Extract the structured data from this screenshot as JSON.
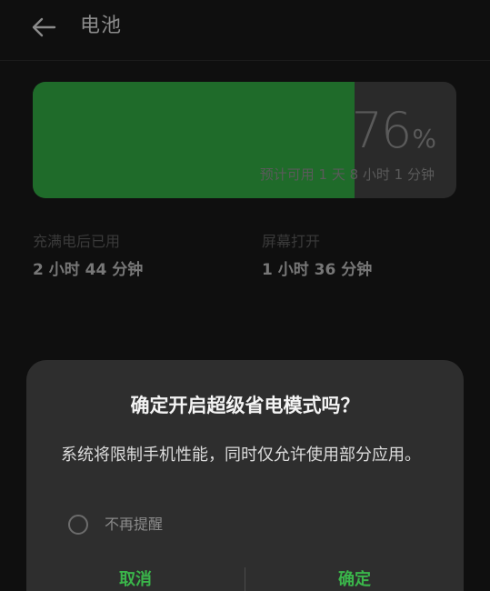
{
  "header": {
    "title": "电池",
    "back_icon": "arrow-left-icon"
  },
  "battery": {
    "level_percent": 76,
    "percent_number": "76",
    "percent_sign": "%",
    "estimate": "预计可用 1 天 8 小时 1 分钟",
    "fill_color": "#1f6b2a"
  },
  "stats": {
    "since_full": {
      "label": "充满电后已用",
      "value": "2 小时 44 分钟"
    },
    "screen_on": {
      "label": "屏幕打开",
      "value": "1 小时 36 分钟"
    }
  },
  "dialog": {
    "title": "确定开启超级省电模式吗？",
    "message": "系统将限制手机性能，同时仅允许使用部分应用。",
    "dont_remind_label": "不再提醒",
    "cancel_label": "取消",
    "confirm_label": "确定",
    "accent_color": "#3ab54a"
  }
}
